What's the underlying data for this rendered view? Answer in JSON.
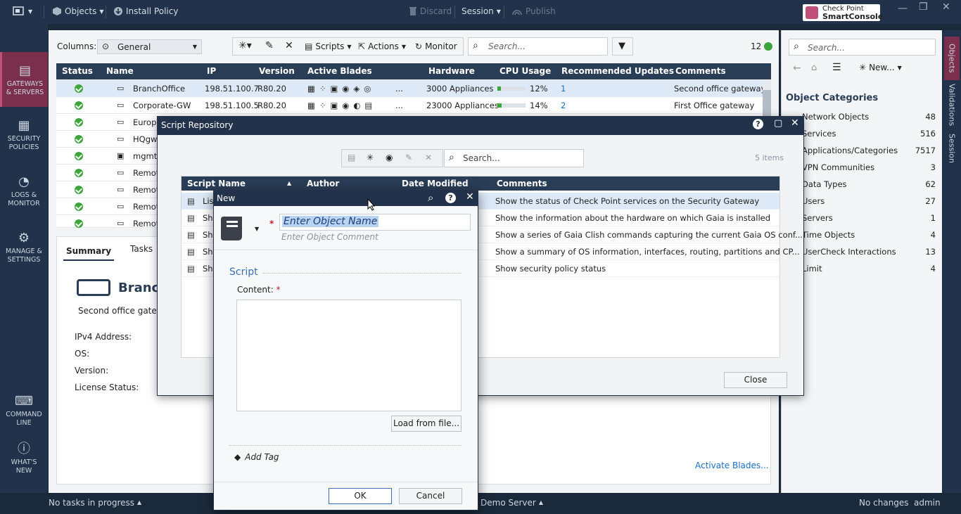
{
  "topbar": {
    "objects": "Objects",
    "install_policy": "Install Policy",
    "discard": "Discard",
    "session": "Session",
    "publish": "Publish",
    "brand_line1": "Check Point",
    "brand_line2": "SmartConsole"
  },
  "leftnav": [
    {
      "label1": "GATEWAYS",
      "label2": "& SERVERS"
    },
    {
      "label1": "SECURITY",
      "label2": "POLICIES"
    },
    {
      "label1": "LOGS &",
      "label2": "MONITOR"
    },
    {
      "label1": "MANAGE &",
      "label2": "SETTINGS"
    },
    {
      "label1": "COMMAND",
      "label2": "LINE"
    },
    {
      "label1": "WHAT'S",
      "label2": "NEW"
    }
  ],
  "toolbar": {
    "columns_label": "Columns:",
    "columns_value": "General",
    "scripts": "Scripts",
    "actions": "Actions",
    "monitor": "Monitor",
    "search_placeholder": "Search...",
    "count": "12"
  },
  "grid": {
    "headers": [
      "Status",
      "Name",
      "IP",
      "Version",
      "Active Blades",
      "Hardware",
      "CPU Usage",
      "Recommended Updates",
      "Comments"
    ],
    "rows": [
      {
        "name": "BranchOffice",
        "ip": "198.51.100.7",
        "version": "R80.20",
        "hardware": "3000 Appliances",
        "cpu": "12%",
        "cpu_fill": 0.12,
        "updates": "1",
        "comment": "Second office gateway"
      },
      {
        "name": "Corporate-GW",
        "ip": "198.51.100.5",
        "version": "R80.20",
        "hardware": "23000 Appliances",
        "cpu": "14%",
        "cpu_fill": 0.14,
        "updates": "2",
        "comment": "First Office gateway"
      },
      {
        "name": "Europe"
      },
      {
        "name": "HQgw"
      },
      {
        "name": "mgmt"
      },
      {
        "name": "Remot"
      },
      {
        "name": "Remot"
      },
      {
        "name": "Remot"
      },
      {
        "name": "Remot"
      }
    ],
    "more": "..."
  },
  "summary": {
    "tab_summary": "Summary",
    "tab_tasks": "Tasks",
    "title": "Branch",
    "comment": "Second office gatewa",
    "ipv4": "IPv4 Address:",
    "os": "OS:",
    "version": "Version:",
    "license": "License Status:",
    "activate": "Activate Blades..."
  },
  "right": {
    "search_placeholder": "Search...",
    "new": "New...",
    "categories_title": "Object Categories",
    "categories": [
      {
        "name": "Network Objects",
        "count": "48"
      },
      {
        "name": "Services",
        "count": "516"
      },
      {
        "name": "Applications/Categories",
        "count": "7517"
      },
      {
        "name": "VPN Communities",
        "count": "3"
      },
      {
        "name": "Data Types",
        "count": "62"
      },
      {
        "name": "Users",
        "count": "27"
      },
      {
        "name": "Servers",
        "count": "1"
      },
      {
        "name": "Time Objects",
        "count": "4"
      },
      {
        "name": "UserCheck Interactions",
        "count": "13"
      },
      {
        "name": "Limit",
        "count": "4"
      }
    ],
    "vtabs": [
      "Objects",
      "Validations",
      "Session"
    ]
  },
  "repo": {
    "title": "Script Repository",
    "search_placeholder": "Search...",
    "items": "5 items",
    "headers": [
      "Script Name",
      "Author",
      "Date Modified",
      "Comments"
    ],
    "rows": [
      {
        "name": "Lis",
        "comment": "Show the status of Check Point services on the Security Gateway"
      },
      {
        "name": "Sh",
        "comment": "Show the information about the hardware on which Gaia is installed"
      },
      {
        "name": "Sh",
        "comment": "Show a series of Gaia Clish commands capturing the current Gaia OS conf..."
      },
      {
        "name": "Sh",
        "comment": "Show a summary of OS information, interfaces, routing, partitions and CP..."
      },
      {
        "name": "Sh",
        "comment": "Show security policy status"
      }
    ],
    "close": "Close"
  },
  "newdlg": {
    "title": "New",
    "name_placeholder": "Enter Object Name",
    "comment_placeholder": "Enter Object Comment",
    "section": "Script",
    "content_label": "Content:",
    "load": "Load from file...",
    "add_tag": "Add Tag",
    "ok": "OK",
    "cancel": "Cancel"
  },
  "status": {
    "tasks": "No tasks in progress",
    "server": "Demo Server",
    "changes": "No changes",
    "user": "admin"
  },
  "colors": {
    "accent": "#7a2f4c",
    "dark": "#22324a",
    "ok": "#3ba53b",
    "link": "#1a6fc4"
  }
}
